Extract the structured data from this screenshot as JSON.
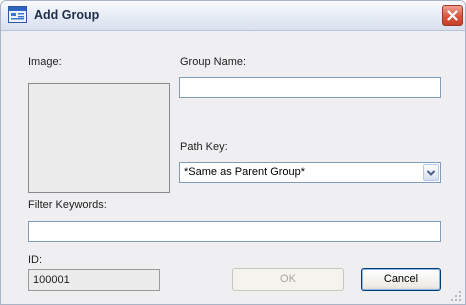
{
  "window": {
    "title": "Add Group",
    "app_icon": "dialog-icon",
    "close_icon": "close-icon"
  },
  "form": {
    "image_label": "Image:",
    "group_name_label": "Group Name:",
    "group_name_value": "",
    "path_key_label": "Path Key:",
    "path_key_value": "*Same as Parent Group*",
    "filter_keywords_label": "Filter Keywords:",
    "filter_keywords_value": "",
    "id_label": "ID:",
    "id_value": "100001"
  },
  "buttons": {
    "ok": "OK",
    "cancel": "Cancel"
  },
  "colors": {
    "close_button": "#d8553d",
    "dialog_background": "#efeff2",
    "disabled_text": "#a6a49a"
  }
}
